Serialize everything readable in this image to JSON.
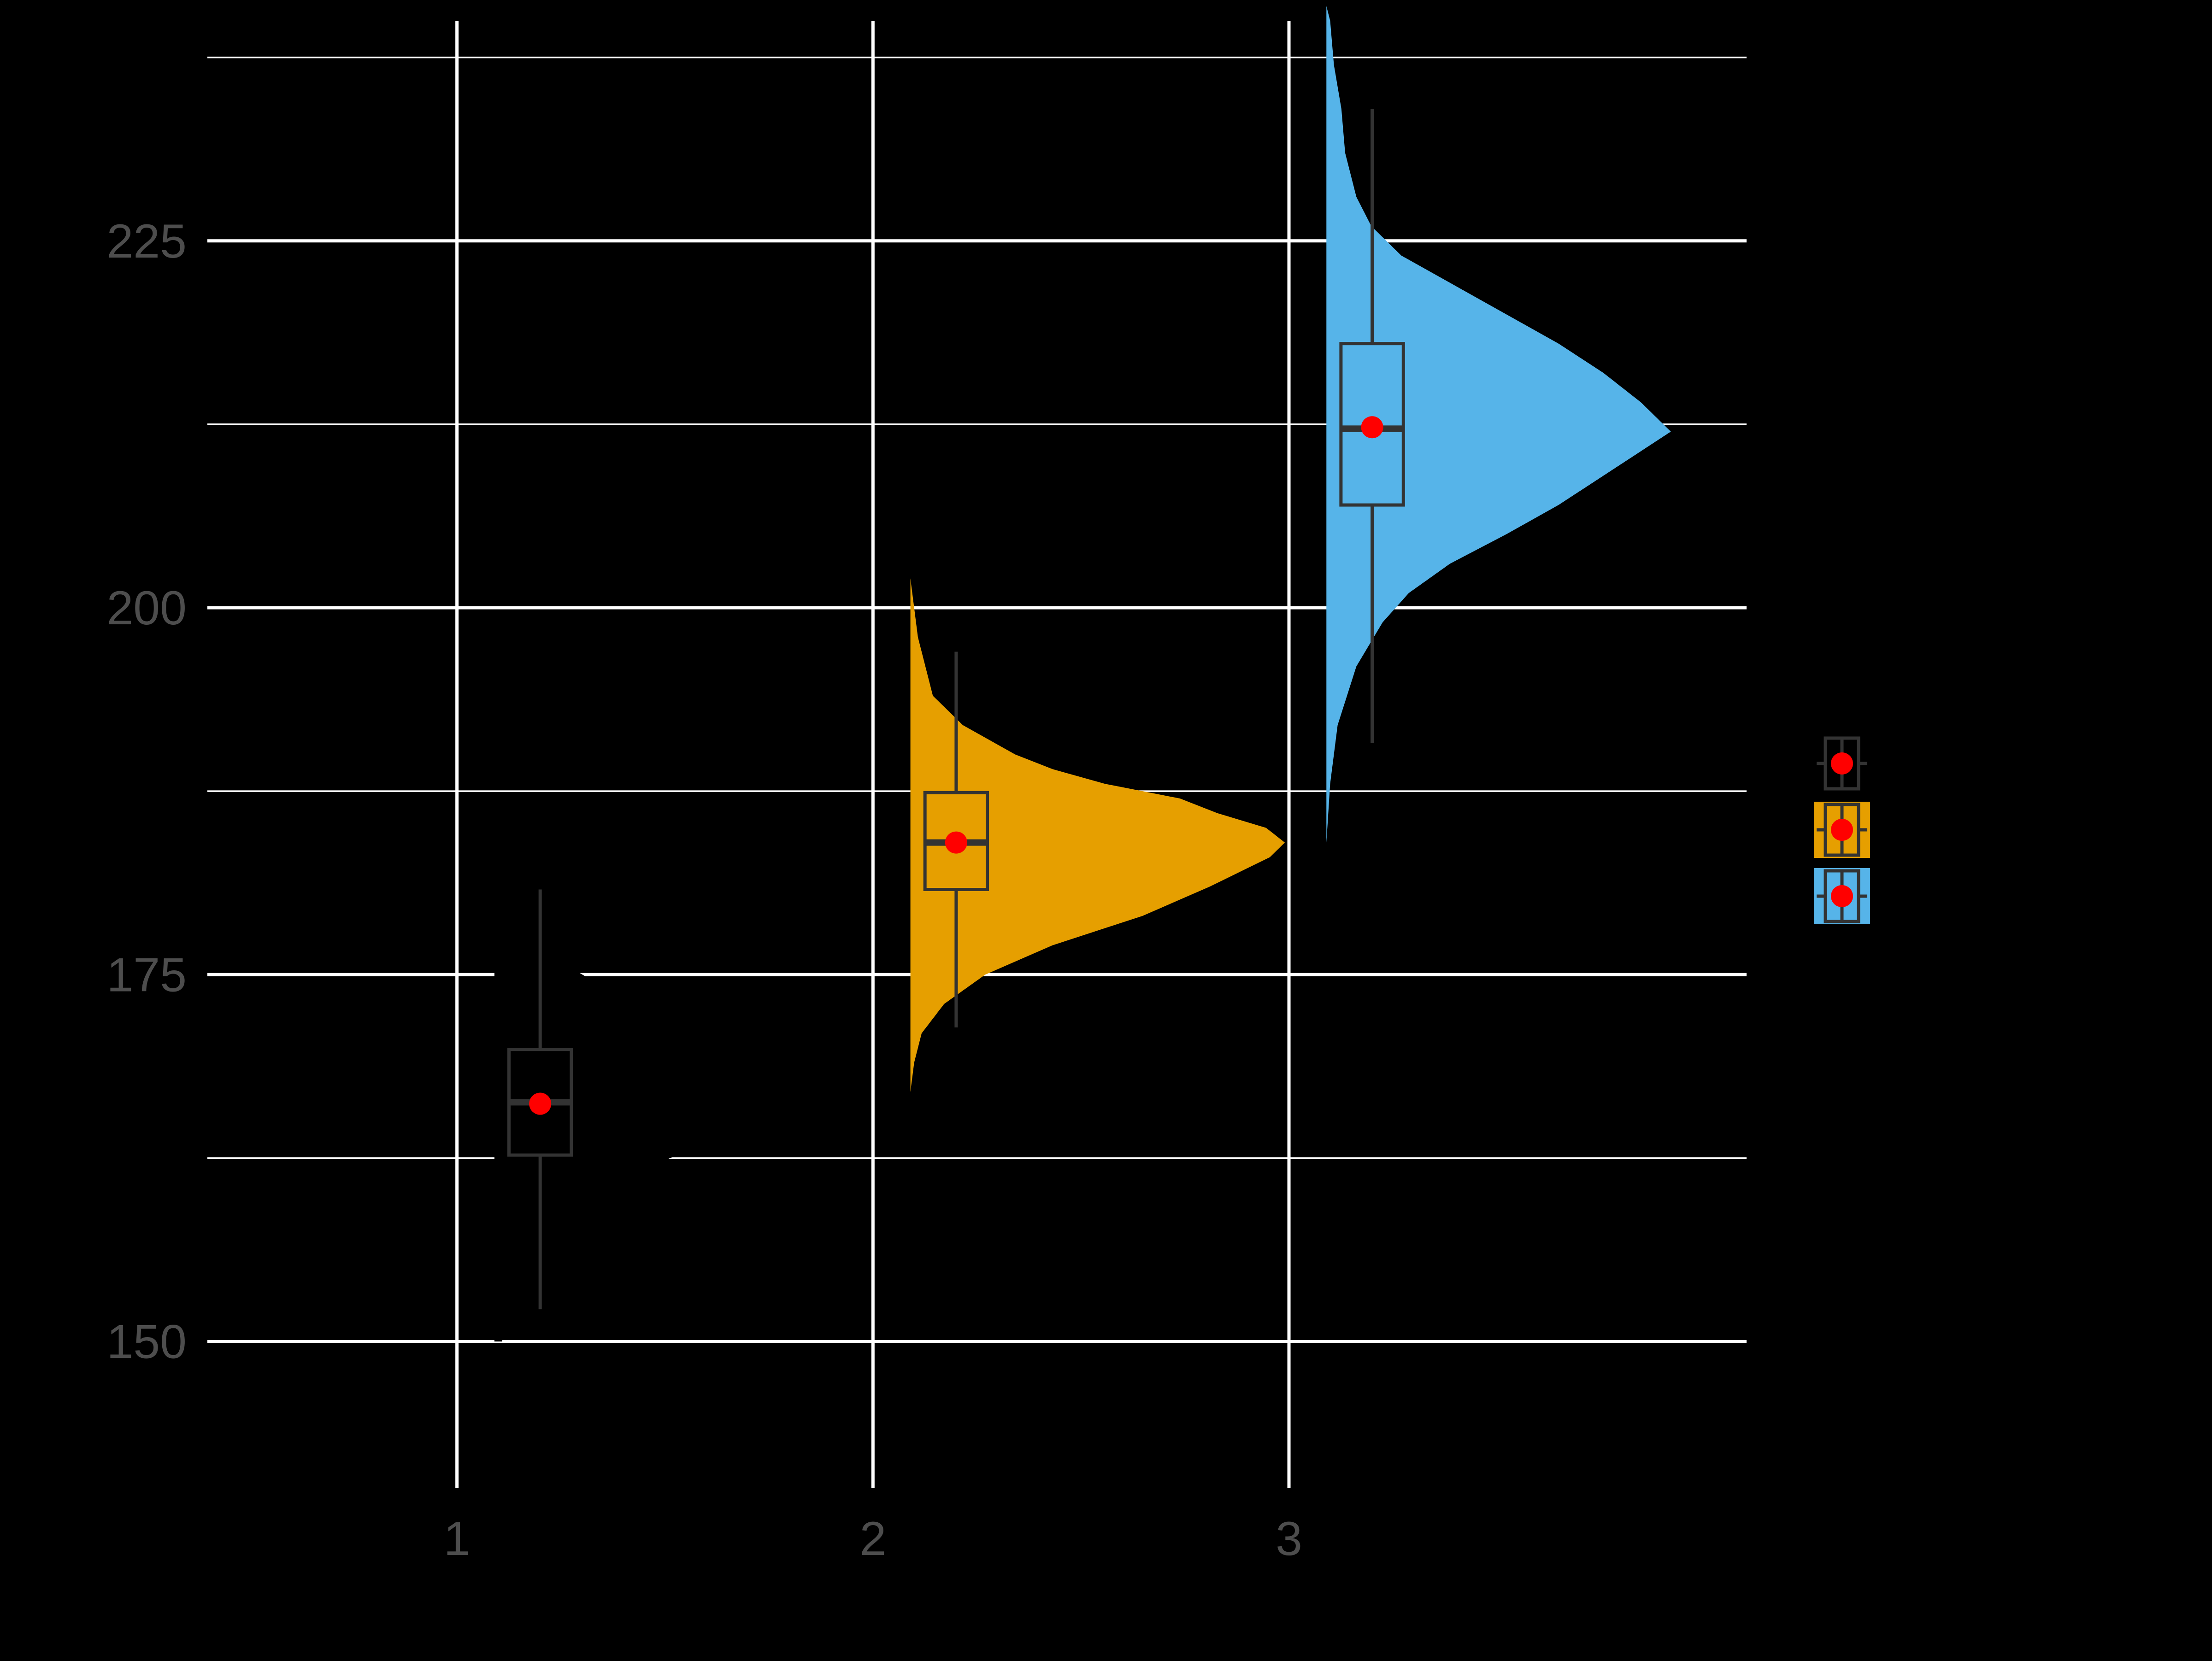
{
  "chart_data": {
    "type": "raincloud",
    "title": "",
    "xlabel": "",
    "ylabel": "",
    "x_ticks": [
      "1",
      "2",
      "3"
    ],
    "y_ticks": [
      "150",
      "175",
      "200",
      "225"
    ],
    "ylim": [
      140,
      240
    ],
    "xlim": [
      0.4,
      4.1
    ],
    "grid": true,
    "legend_position": "right",
    "background_color": "#000000",
    "grid_color": "#FFFFFF",
    "tick_label_color": "#4D4D4D",
    "box_line_color": "#333333",
    "mean_marker_color": "#FF0000",
    "series": [
      {
        "x": 1,
        "fill": "#000000",
        "box": {
          "min": 152.2,
          "q1": 162.7,
          "median": 166.3,
          "q3": 169.9,
          "max": 180.8
        },
        "mean": 166.2,
        "density": [
          [
            150,
            0.02
          ],
          [
            153,
            0.06
          ],
          [
            156,
            0.12
          ],
          [
            159,
            0.24
          ],
          [
            162,
            0.42
          ],
          [
            164,
            0.62
          ],
          [
            166,
            0.8
          ],
          [
            167,
            0.86
          ],
          [
            168,
            0.82
          ],
          [
            170,
            0.68
          ],
          [
            172,
            0.48
          ],
          [
            174,
            0.3
          ],
          [
            176,
            0.17
          ],
          [
            178,
            0.08
          ],
          [
            181,
            0.03
          ],
          [
            184,
            0.01
          ]
        ]
      },
      {
        "x": 2,
        "fill": "#E69F00",
        "box": {
          "min": 171.4,
          "q1": 180.8,
          "median": 184.0,
          "q3": 187.4,
          "max": 197.0
        },
        "mean": 184.0,
        "density": [
          [
            167,
            0.0
          ],
          [
            169,
            0.01
          ],
          [
            171,
            0.03
          ],
          [
            173,
            0.09
          ],
          [
            175,
            0.2
          ],
          [
            177,
            0.38
          ],
          [
            179,
            0.62
          ],
          [
            181,
            0.8
          ],
          [
            182,
            0.88
          ],
          [
            183,
            0.96
          ],
          [
            184,
            1.0
          ],
          [
            185,
            0.95
          ],
          [
            186,
            0.82
          ],
          [
            187,
            0.72
          ],
          [
            188,
            0.52
          ],
          [
            189,
            0.38
          ],
          [
            190,
            0.28
          ],
          [
            192,
            0.14
          ],
          [
            194,
            0.06
          ],
          [
            196,
            0.04
          ],
          [
            198,
            0.02
          ],
          [
            200,
            0.01
          ],
          [
            202,
            0.0
          ],
          [
            204,
            0.0
          ]
        ]
      },
      {
        "x": 3,
        "fill": "#56B4E9",
        "box": {
          "min": 190.8,
          "q1": 207.0,
          "median": 212.2,
          "q3": 218.0,
          "max": 234.0
        },
        "mean": 212.3,
        "density": [
          [
            172,
            0.0
          ],
          [
            178,
            0.0
          ],
          [
            184,
            0.0
          ],
          [
            188,
            0.01
          ],
          [
            192,
            0.03
          ],
          [
            196,
            0.08
          ],
          [
            199,
            0.15
          ],
          [
            201,
            0.22
          ],
          [
            203,
            0.33
          ],
          [
            205,
            0.48
          ],
          [
            207,
            0.62
          ],
          [
            209,
            0.74
          ],
          [
            211,
            0.86
          ],
          [
            212,
            0.92
          ],
          [
            214,
            0.84
          ],
          [
            216,
            0.74
          ],
          [
            218,
            0.62
          ],
          [
            220,
            0.48
          ],
          [
            222,
            0.34
          ],
          [
            224,
            0.2
          ],
          [
            226,
            0.12
          ],
          [
            228,
            0.08
          ],
          [
            231,
            0.05
          ],
          [
            234,
            0.04
          ],
          [
            237,
            0.02
          ],
          [
            240,
            0.01
          ],
          [
            241,
            0.0
          ]
        ]
      }
    ]
  }
}
